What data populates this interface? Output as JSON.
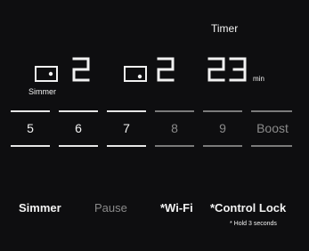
{
  "timer": {
    "label": "Timer",
    "minutes": "23",
    "unit": "min"
  },
  "burners": [
    {
      "label": "Simmer",
      "value": "2"
    },
    {
      "label": "",
      "value": "2"
    }
  ],
  "levels": [
    {
      "label": "5",
      "active": true
    },
    {
      "label": "6",
      "active": true
    },
    {
      "label": "7",
      "active": true
    },
    {
      "label": "8",
      "active": false
    },
    {
      "label": "9",
      "active": false
    },
    {
      "label": "Boost",
      "active": false
    }
  ],
  "buttons": {
    "simmer": "Simmer",
    "pause": "Pause",
    "wifi": "*Wi-Fi",
    "control_lock": "*Control Lock",
    "hold_note": "* Hold 3 seconds"
  },
  "colors": {
    "background": "#0e0e10",
    "active_text": "#f2f2f2",
    "inactive_text": "#8a8a8a"
  }
}
